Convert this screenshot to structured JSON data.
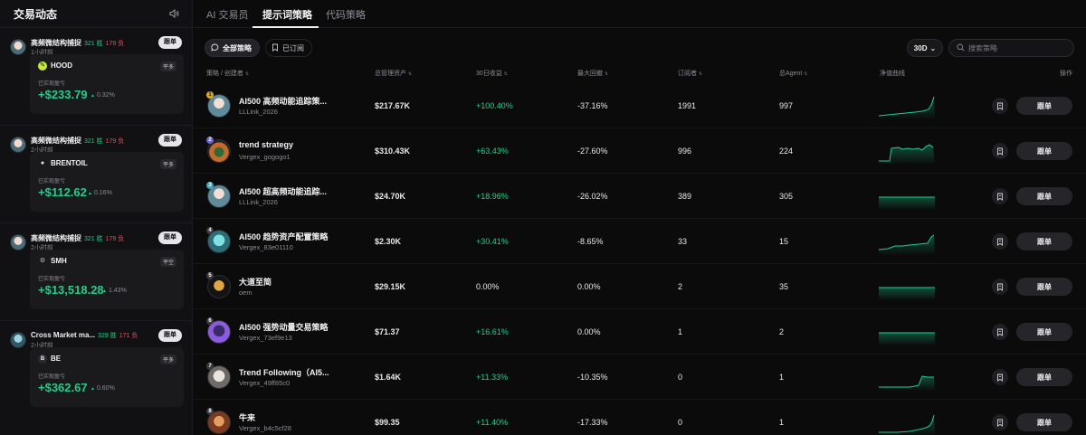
{
  "sidebar": {
    "title": "交易动态",
    "trades": [
      {
        "name": "高频微结构捕捉",
        "wins": "321 胜",
        "losses": "179 负",
        "time": "1小时前",
        "follow": "跟单",
        "ticker": "HOOD",
        "icon": "hood-icon",
        "side": "平多",
        "pnl_label": "已实现盈亏",
        "pnl": "+$233.79",
        "pct": "0.32%"
      },
      {
        "name": "高频微结构捕捉",
        "wins": "321 胜",
        "losses": "179 负",
        "time": "2小时前",
        "follow": "跟单",
        "ticker": "BRENTOIL",
        "icon": "oil-drop-icon",
        "side": "平多",
        "pnl_label": "已实现盈亏",
        "pnl": "+$112.62",
        "pct": "0.16%"
      },
      {
        "name": "高频微结构捕捉",
        "wins": "321 胜",
        "losses": "179 负",
        "time": "2小时前",
        "follow": "跟单",
        "ticker": "SMH",
        "icon": "gear-icon",
        "side": "平空",
        "pnl_label": "已实现盈亏",
        "pnl": "+$13,518.28",
        "pct": "1.43%"
      },
      {
        "name": "Cross Market ma...",
        "wins": "329 胜",
        "losses": "171 负",
        "time": "2小时前",
        "follow": "跟单",
        "ticker": "BE",
        "icon": "be-icon",
        "side": "平多",
        "pnl_label": "已实现盈亏",
        "pnl": "+$362.67",
        "pct": "0.60%"
      }
    ]
  },
  "tabs": [
    "AI 交易员",
    "提示词策略",
    "代码策略"
  ],
  "filters": {
    "all": "全部策略",
    "subscribed": "已订阅"
  },
  "period": "30D",
  "search": {
    "placeholder": "搜索策略"
  },
  "columns": [
    "策略 / 创建者",
    "总管理资产",
    "30日收益",
    "最大回撤",
    "订阅者",
    "总Agent",
    "净值曲线",
    "操作"
  ],
  "rows": [
    {
      "rank": "1",
      "name": "AI500 高频动能追踪策...",
      "creator": "LLLink_2026",
      "aum": "$217.67K",
      "ret": "+100.40%",
      "dd": "-37.16%",
      "subs": "1991",
      "agents": "997",
      "follow": "跟单"
    },
    {
      "rank": "2",
      "name": "trend strategy",
      "creator": "Vergex_gogogo1",
      "aum": "$310.43K",
      "ret": "+63.43%",
      "dd": "-27.60%",
      "subs": "996",
      "agents": "224",
      "follow": "跟单"
    },
    {
      "rank": "3",
      "name": "AI500 超高频动能追踪...",
      "creator": "LLLink_2026",
      "aum": "$24.70K",
      "ret": "+18.96%",
      "dd": "-26.02%",
      "subs": "389",
      "agents": "305",
      "follow": "跟单"
    },
    {
      "rank": "4",
      "name": "AI500 趋势资产配置策略",
      "creator": "Vergex_83e01110",
      "aum": "$2.30K",
      "ret": "+30.41%",
      "dd": "-8.65%",
      "subs": "33",
      "agents": "15",
      "follow": "跟单"
    },
    {
      "rank": "5",
      "name": "大道至简",
      "creator": "oem",
      "aum": "$29.15K",
      "ret": "0.00%",
      "dd": "0.00%",
      "subs": "2",
      "agents": "35",
      "follow": "跟单"
    },
    {
      "rank": "6",
      "name": "AI500 强势动量交易策略",
      "creator": "Vergex_73ef9e13",
      "aum": "$71.37",
      "ret": "+16.61%",
      "dd": "0.00%",
      "subs": "1",
      "agents": "2",
      "follow": "跟单"
    },
    {
      "rank": "7",
      "name": "Trend Following（AI5...",
      "creator": "Vergex_49ff85c0",
      "aum": "$1.64K",
      "ret": "+11.33%",
      "dd": "-10.35%",
      "subs": "0",
      "agents": "1",
      "follow": "跟单"
    },
    {
      "rank": "8",
      "name": "牛来",
      "creator": "Vergex_b4c5cf28",
      "aum": "$99.35",
      "ret": "+11.40%",
      "dd": "-17.33%",
      "subs": "0",
      "agents": "1",
      "follow": "跟单"
    }
  ],
  "colors": {
    "accent": "#1fce8c",
    "loss": "#ef4b5b",
    "bg": "#0b0b0c"
  }
}
